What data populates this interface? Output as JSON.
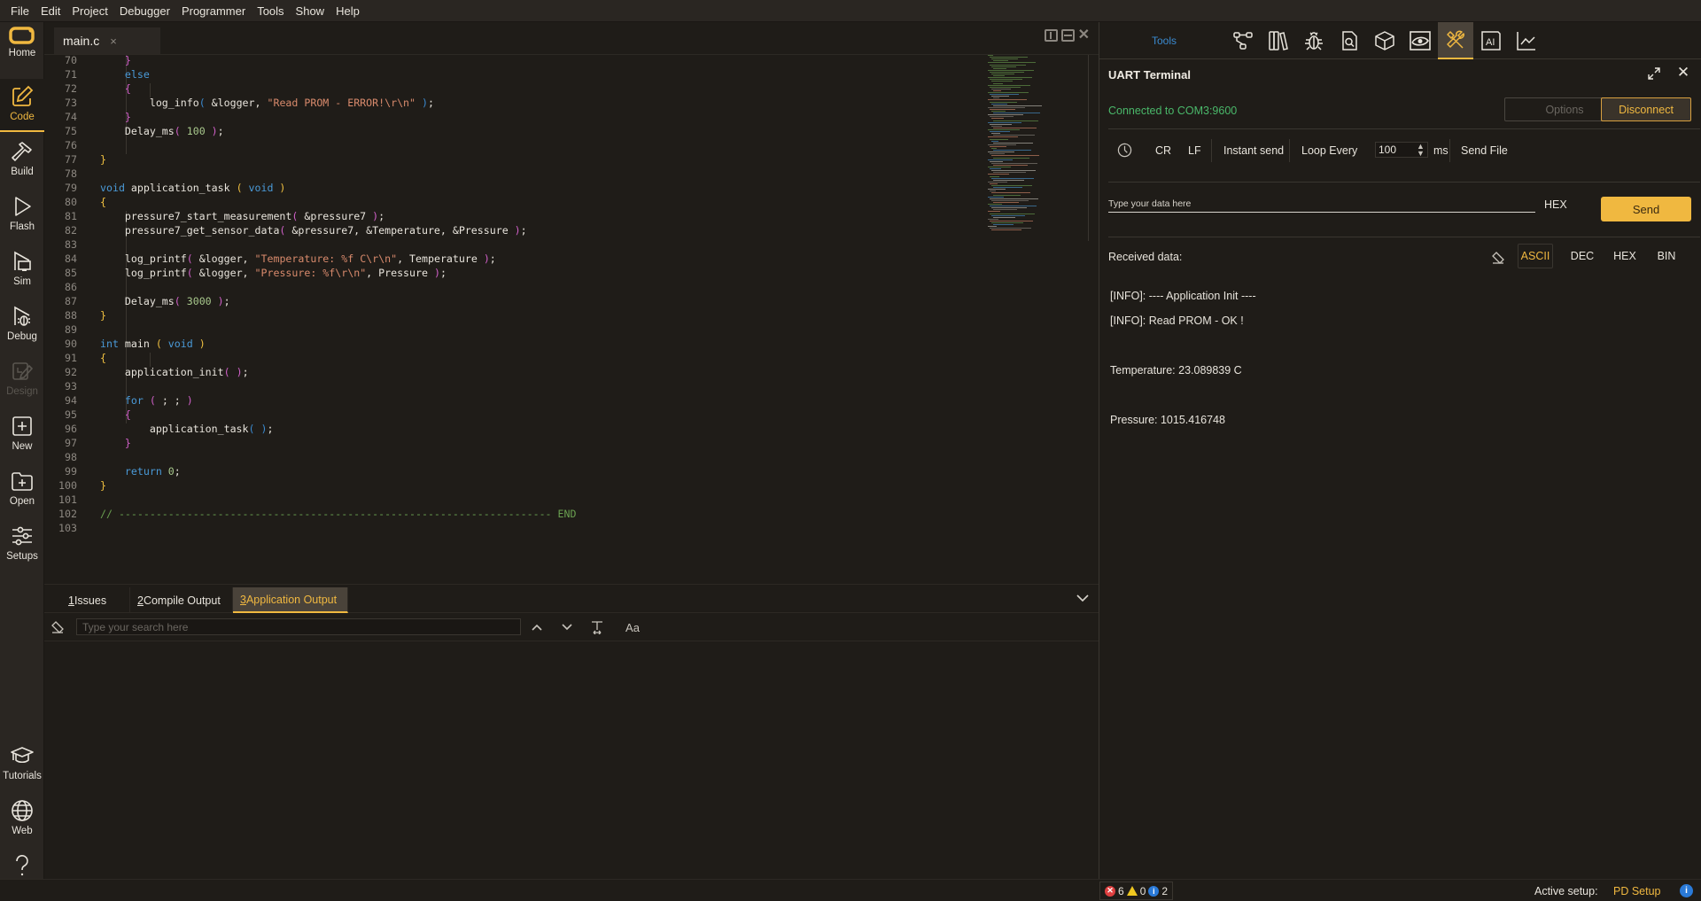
{
  "menubar": {
    "items": [
      "File",
      "Edit",
      "Project",
      "Debugger",
      "Programmer",
      "Tools",
      "Show",
      "Help"
    ]
  },
  "sidebar": {
    "items": [
      {
        "label": "Home",
        "icon": "logo-icon"
      },
      {
        "label": "Code",
        "icon": "pencil-square-icon",
        "active": true
      },
      {
        "label": "Build",
        "icon": "hammer-icon"
      },
      {
        "label": "Flash",
        "icon": "play-icon"
      },
      {
        "label": "Sim",
        "icon": "simulator-icon"
      },
      {
        "label": "Debug",
        "icon": "debug-bug-icon"
      },
      {
        "label": "Design",
        "icon": "design-icon",
        "disabled": true
      },
      {
        "label": "New",
        "icon": "plus-square-icon"
      },
      {
        "label": "Open",
        "icon": "folder-plus-icon"
      },
      {
        "label": "Setups",
        "icon": "sliders-icon"
      },
      {
        "label": "Tutorials",
        "icon": "graduation-cap-icon"
      },
      {
        "label": "Web",
        "icon": "globe-icon"
      },
      {
        "label": "Help",
        "icon": "question-icon"
      }
    ]
  },
  "editor": {
    "tab_label": "main.c",
    "tab_close": "×",
    "lines": [
      {
        "n": "70",
        "html_key": 0
      },
      {
        "n": "71"
      },
      {
        "n": "72"
      },
      {
        "n": "73"
      },
      {
        "n": "74"
      },
      {
        "n": "75"
      },
      {
        "n": "76"
      },
      {
        "n": "77"
      },
      {
        "n": "78"
      },
      {
        "n": "79"
      },
      {
        "n": "80"
      },
      {
        "n": "81"
      },
      {
        "n": "82"
      },
      {
        "n": "83"
      },
      {
        "n": "84"
      },
      {
        "n": "85"
      },
      {
        "n": "86"
      },
      {
        "n": "87"
      },
      {
        "n": "88"
      },
      {
        "n": "89"
      },
      {
        "n": "90"
      },
      {
        "n": "91"
      },
      {
        "n": "92"
      },
      {
        "n": "93"
      },
      {
        "n": "94"
      },
      {
        "n": "95"
      },
      {
        "n": "96"
      },
      {
        "n": "97"
      },
      {
        "n": "98"
      },
      {
        "n": "99"
      },
      {
        "n": "100"
      },
      {
        "n": "101"
      },
      {
        "n": "102"
      },
      {
        "n": "103"
      }
    ],
    "code": [
      [
        [
          "br-p",
          "    }"
        ]
      ],
      [
        [
          "kw",
          "    else"
        ]
      ],
      [
        [
          "br-p",
          "    {"
        ]
      ],
      [
        [
          "",
          "        log_info"
        ],
        [
          "br-b",
          "("
        ],
        [
          "",
          " &logger, "
        ],
        [
          "str",
          "\"Read PROM - ERROR!\\r\\n\""
        ],
        [
          "br-b",
          " )"
        ],
        [
          "",
          ";"
        ]
      ],
      [
        [
          "br-p",
          "    }"
        ]
      ],
      [
        [
          "",
          "    Delay_ms"
        ],
        [
          "br-p",
          "("
        ],
        [
          "num",
          " 100"
        ],
        [
          "br-p",
          " )"
        ],
        [
          "",
          ";"
        ]
      ],
      [],
      [
        [
          "br-y",
          "}"
        ]
      ],
      [],
      [
        [
          "kw",
          "void"
        ],
        [
          "",
          " application_task "
        ],
        [
          "br-y",
          "("
        ],
        [
          "kw",
          " void"
        ],
        [
          "br-y",
          " )"
        ]
      ],
      [
        [
          "br-y",
          "{"
        ]
      ],
      [
        [
          "",
          "    pressure7_start_measurement"
        ],
        [
          "br-p",
          "("
        ],
        [
          "",
          " &pressure7 "
        ],
        [
          "br-p",
          ")"
        ],
        [
          "",
          ";"
        ]
      ],
      [
        [
          "",
          "    pressure7_get_sensor_data"
        ],
        [
          "br-p",
          "("
        ],
        [
          "",
          " &pressure7, &Temperature, &Pressure "
        ],
        [
          "br-p",
          ")"
        ],
        [
          "",
          ";"
        ]
      ],
      [],
      [
        [
          "",
          "    log_printf"
        ],
        [
          "br-p",
          "("
        ],
        [
          "",
          " &logger, "
        ],
        [
          "str",
          "\"Temperature: %f C\\r\\n\""
        ],
        [
          "",
          ", Temperature "
        ],
        [
          "br-p",
          ")"
        ],
        [
          "",
          ";"
        ]
      ],
      [
        [
          "",
          "    log_printf"
        ],
        [
          "br-p",
          "("
        ],
        [
          "",
          " &logger, "
        ],
        [
          "str",
          "\"Pressure: %f\\r\\n\""
        ],
        [
          "",
          ", Pressure "
        ],
        [
          "br-p",
          ")"
        ],
        [
          "",
          ";"
        ]
      ],
      [],
      [
        [
          "",
          "    Delay_ms"
        ],
        [
          "br-p",
          "("
        ],
        [
          "num",
          " 3000"
        ],
        [
          "br-p",
          " )"
        ],
        [
          "",
          ";"
        ]
      ],
      [
        [
          "br-y",
          "}"
        ]
      ],
      [],
      [
        [
          "kw",
          "int"
        ],
        [
          "",
          " main "
        ],
        [
          "br-y",
          "("
        ],
        [
          "kw",
          " void"
        ],
        [
          "br-y",
          " )"
        ]
      ],
      [
        [
          "br-y",
          "{"
        ]
      ],
      [
        [
          "",
          "    application_init"
        ],
        [
          "br-p",
          "("
        ],
        [
          "br-p",
          " )"
        ],
        [
          "",
          ";"
        ]
      ],
      [],
      [
        [
          "kw",
          "    for"
        ],
        [
          "br-p",
          " ( "
        ],
        [
          "",
          "; ; "
        ],
        [
          "br-p",
          ")"
        ]
      ],
      [
        [
          "br-p",
          "    {"
        ]
      ],
      [
        [
          "",
          "        application_task"
        ],
        [
          "br-b",
          "("
        ],
        [
          "br-b",
          " )"
        ],
        [
          "",
          ";"
        ]
      ],
      [
        [
          "br-p",
          "    }"
        ]
      ],
      [],
      [
        [
          "kw",
          "    return"
        ],
        [
          "num",
          " 0"
        ],
        [
          "",
          ";"
        ]
      ],
      [
        [
          "br-y",
          "}"
        ]
      ],
      [],
      [
        [
          "cmt",
          "// ---------------------------------------------------------------------- END"
        ]
      ],
      []
    ]
  },
  "bottom_panel": {
    "tabs": [
      {
        "num": "1",
        "label": " Issues"
      },
      {
        "num": "2",
        "label": " Compile Output"
      },
      {
        "num": "3",
        "label": " Application Output",
        "active": true
      }
    ],
    "search_placeholder": "Type your search here",
    "case_label": "Aa"
  },
  "tools_panel": {
    "label": "Tools",
    "icons": [
      "hierarchy-icon",
      "library-books-icon",
      "bug-icon",
      "file-search-icon",
      "package-cube-icon",
      "eye-view-icon",
      "tools-wrench-icon",
      "ai-icon",
      "chart-line-icon"
    ],
    "active_index": 6
  },
  "uart": {
    "title": "UART Terminal",
    "status": "Connected to COM3:9600",
    "status_color": "#4ab86a",
    "options_label": "Options",
    "disconnect_label": "Disconnect",
    "send_options": {
      "cr": "CR",
      "lf": "LF",
      "instant_send": "Instant send",
      "loop_every": "Loop Every",
      "loop_value": "100",
      "loop_unit": "ms",
      "send_file": "Send File"
    },
    "input_placeholder": "Type your data here",
    "hex_toggle": "HEX",
    "send_label": "Send",
    "received_label": "Received data:",
    "formats": [
      "ASCII",
      "DEC",
      "HEX",
      "BIN"
    ],
    "active_format": "ASCII",
    "received_lines": [
      "[INFO]: ---- Application Init ----",
      "[INFO]: Read PROM - OK !",
      "",
      "Temperature: 23.089839 C",
      "",
      "Pressure: 1015.416748"
    ]
  },
  "statusbar": {
    "errors": "6",
    "warnings": "0",
    "infos": "2",
    "active_setup_label": "Active setup:",
    "active_setup_value": "PD Setup"
  },
  "colors": {
    "accent": "#f0b840",
    "link": "#3a8ad0",
    "connected": "#4ab86a",
    "error": "#e04040",
    "warning": "#f0c820",
    "info": "#2a7ad8"
  }
}
